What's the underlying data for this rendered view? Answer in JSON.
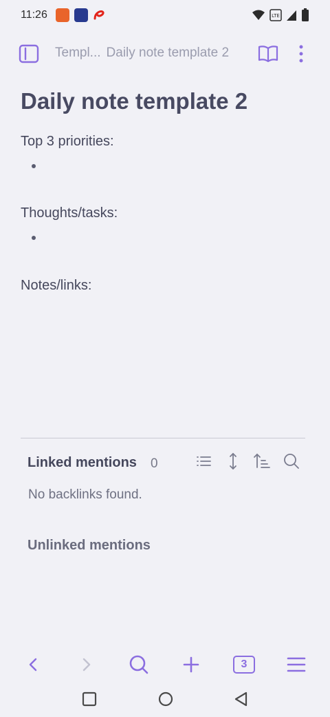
{
  "status_bar": {
    "time": "11:26",
    "notification_icons": [
      "shopping-app-icon",
      "tv-app-icon",
      "airtel-app-icon"
    ],
    "right_icons": [
      "wifi-icon",
      "volte-icon",
      "signal-icon",
      "battery-icon"
    ]
  },
  "toolbar": {
    "breadcrumb_parent": "Templ...",
    "breadcrumb_current": "Daily note template 2",
    "icons": [
      "sidebar-toggle-icon",
      "book-open-icon",
      "more-vertical-icon"
    ]
  },
  "note": {
    "title": "Daily note template 2",
    "sections": [
      {
        "heading": "Top 3 priorities:",
        "bullets": 1
      },
      {
        "heading": "Thoughts/tasks:",
        "bullets": 1
      },
      {
        "heading": "Notes/links:",
        "bullets": 0
      }
    ]
  },
  "backlinks": {
    "linked_title": "Linked mentions",
    "linked_count": "0",
    "empty_text": "No backlinks found.",
    "unlinked_title": "Unlinked mentions",
    "tools": [
      "list-icon",
      "expand-icon",
      "sort-icon",
      "search-icon"
    ]
  },
  "bottom_nav": {
    "tab_count": "3",
    "icons": [
      "back-icon",
      "forward-icon",
      "search-icon",
      "plus-icon",
      "tabs-icon",
      "menu-icon"
    ]
  },
  "system_nav": {
    "icons": [
      "recents-icon",
      "home-icon",
      "back-triangle-icon"
    ]
  },
  "colors": {
    "accent": "#8b6ee0",
    "background": "#f1f1f6",
    "text": "#45475c"
  }
}
